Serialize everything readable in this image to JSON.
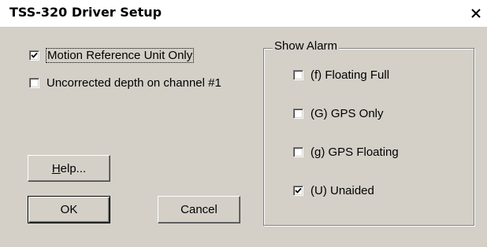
{
  "window": {
    "title": "TSS-320 Driver Setup",
    "close_icon": "close-x-icon"
  },
  "options": {
    "motion_reference": {
      "label": "Motion Reference Unit Only",
      "checked": true
    },
    "uncorrected_depth": {
      "label": "Uncorrected depth on channel #1",
      "checked": false
    }
  },
  "show_alarm": {
    "legend": "Show Alarm",
    "items": [
      {
        "label": "(f) Floating Full",
        "checked": false
      },
      {
        "label": "(G) GPS Only",
        "checked": false
      },
      {
        "label": "(g) GPS Floating",
        "checked": false
      },
      {
        "label": "(U) Unaided",
        "checked": true
      }
    ]
  },
  "buttons": {
    "help": {
      "label_mnemonic": "H",
      "label_rest": "elp..."
    },
    "ok": "OK",
    "cancel": "Cancel"
  }
}
